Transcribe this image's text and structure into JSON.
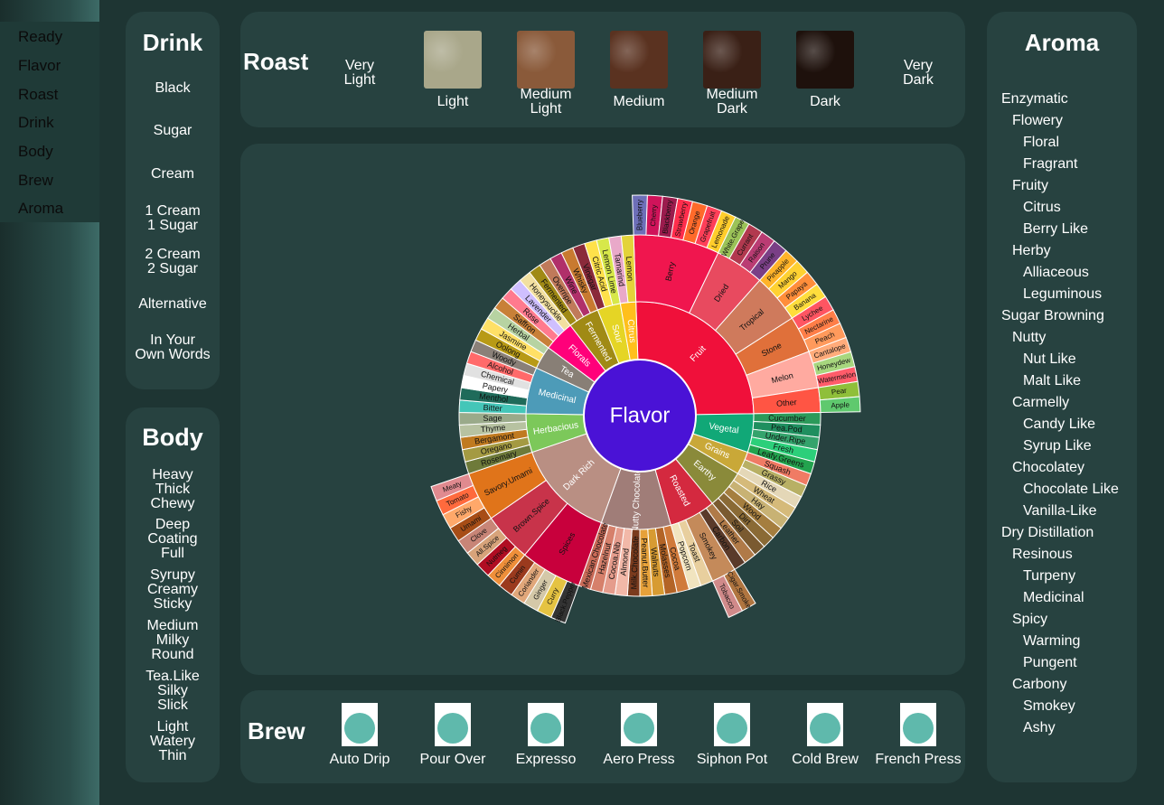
{
  "nav": {
    "items": [
      "Ready",
      "Flavor",
      "Roast",
      "Drink",
      "Body",
      "Brew",
      "Aroma"
    ]
  },
  "drink": {
    "title": "Drink",
    "options": [
      "Black",
      "Sugar",
      "Cream",
      "1 Cream\n1 Sugar",
      "2 Cream\n2 Sugar",
      "Alternative",
      "In Your\nOwn Words"
    ]
  },
  "body": {
    "title": "Body",
    "options": [
      "Heavy\nThick\nChewy",
      "Deep\nCoating\nFull",
      "Syrupy\nCreamy\nSticky",
      "Medium\nMilky\nRound",
      "Tea.Like\nSilky\nSlick",
      "Light\nWatery\nThin"
    ]
  },
  "roast": {
    "title": "Roast",
    "options": [
      {
        "label": "Very\nLight",
        "image": false
      },
      {
        "label": "Light",
        "image": true,
        "color": "#a9a78a"
      },
      {
        "label": "Medium\nLight",
        "image": true,
        "color": "#8a5a3a"
      },
      {
        "label": "Medium",
        "image": true,
        "color": "#5a3220"
      },
      {
        "label": "Medium\nDark",
        "image": true,
        "color": "#3a2016"
      },
      {
        "label": "Dark",
        "image": true,
        "color": "#1e110c"
      },
      {
        "label": "Very\nDark",
        "image": false
      }
    ]
  },
  "brew": {
    "title": "Brew",
    "options": [
      "Auto Drip",
      "Pour Over",
      "Expresso",
      "Aero Press",
      "Siphon Pot",
      "Cold Brew",
      "French Press"
    ]
  },
  "aroma": {
    "title": "Aroma",
    "items": [
      {
        "label": "Enzymatic",
        "level": 0
      },
      {
        "label": "Flowery",
        "level": 1
      },
      {
        "label": "Floral",
        "level": 2
      },
      {
        "label": "Fragrant",
        "level": 2
      },
      {
        "label": "Fruity",
        "level": 1
      },
      {
        "label": "Citrus",
        "level": 2
      },
      {
        "label": "Berry Like",
        "level": 2
      },
      {
        "label": "Herby",
        "level": 1
      },
      {
        "label": "Alliaceous",
        "level": 2
      },
      {
        "label": "Leguminous",
        "level": 2
      },
      {
        "label": "Sugar Browning",
        "level": 0
      },
      {
        "label": "Nutty",
        "level": 1
      },
      {
        "label": "Nut Like",
        "level": 2
      },
      {
        "label": "Malt Like",
        "level": 2
      },
      {
        "label": "Carmelly",
        "level": 1
      },
      {
        "label": "Candy Like",
        "level": 2
      },
      {
        "label": "Syrup Like",
        "level": 2
      },
      {
        "label": "Chocolatey",
        "level": 1
      },
      {
        "label": "Chocolate Like",
        "level": 2
      },
      {
        "label": "Vanilla-Like",
        "level": 2
      },
      {
        "label": "Dry Distillation",
        "level": 0
      },
      {
        "label": "Resinous",
        "level": 1
      },
      {
        "label": "Turpeny",
        "level": 2
      },
      {
        "label": "Medicinal",
        "level": 2
      },
      {
        "label": "Spicy",
        "level": 1
      },
      {
        "label": "Warming",
        "level": 2
      },
      {
        "label": "Pungent",
        "level": 2
      },
      {
        "label": "Carbony",
        "level": 1
      },
      {
        "label": "Smokey",
        "level": 2
      },
      {
        "label": "Ashy",
        "level": 2
      }
    ]
  },
  "flavor": {
    "center": "Flavor",
    "center_color": "#4a12d6",
    "wheel": [
      {
        "name": "Fruit",
        "color": "#f0103a",
        "children": [
          {
            "name": "Berry",
            "color": "#f0164e",
            "children": [
              {
                "name": "Blueberry",
                "color": "#6d6fb8"
              },
              {
                "name": "Cherry",
                "color": "#d0135a"
              },
              {
                "name": "Blackberry",
                "color": "#9b1b4d"
              },
              {
                "name": "Strawberry",
                "color": "#ff2d4c"
              },
              {
                "name": "Orange",
                "color": "#ff6a2a"
              },
              {
                "name": "Grapefruit",
                "color": "#ff3f58"
              },
              {
                "name": "Lemonade",
                "color": "#ffcd2b"
              }
            ]
          },
          {
            "name": "Dried",
            "color": "#e84a5f",
            "children": [
              {
                "name": "White.Grape",
                "color": "#9bc358"
              },
              {
                "name": "Currant",
                "color": "#b2394f"
              },
              {
                "name": "Raison",
                "color": "#ba3c73"
              },
              {
                "name": "Prune",
                "color": "#7a3f86"
              }
            ]
          },
          {
            "name": "Tropical",
            "color": "#cf7a5c",
            "children": [
              {
                "name": "Pinapple",
                "color": "#ffb329"
              },
              {
                "name": "Mango",
                "color": "#ffd131"
              },
              {
                "name": "Papaya",
                "color": "#ff8e3a"
              },
              {
                "name": "Banana",
                "color": "#ffdd3c"
              }
            ]
          },
          {
            "name": "Stone",
            "color": "#e0703a",
            "children": [
              {
                "name": "Lychee",
                "color": "#ff5562"
              },
              {
                "name": "Nectarine",
                "color": "#ff7e48"
              },
              {
                "name": "Peach",
                "color": "#ff9a5c"
              }
            ]
          },
          {
            "name": "Melon",
            "color": "#ffaaa0",
            "children": [
              {
                "name": "Cantalope",
                "color": "#ffab7a"
              },
              {
                "name": "Honeydew",
                "color": "#a7d77e"
              },
              {
                "name": "Watermelon",
                "color": "#ff5c6a"
              }
            ]
          },
          {
            "name": "Other",
            "color": "#ff5544",
            "children": [
              {
                "name": "Pear",
                "color": "#8fbf3a"
              },
              {
                "name": "Apple",
                "color": "#5fc96e"
              }
            ]
          }
        ]
      },
      {
        "name": "Vegetal",
        "color": "#11a877",
        "children": [
          {
            "name": "Cucumber",
            "color": "#2b9a5a",
            "children": []
          },
          {
            "name": "Pea.Pod",
            "color": "#1f8f5f",
            "children": []
          },
          {
            "name": "Under.Ripe",
            "color": "#34a36c",
            "children": []
          },
          {
            "name": "Fresh",
            "color": "#2ccf7a",
            "children": []
          },
          {
            "name": "Leafy.Greens",
            "color": "#23a34e",
            "children": []
          }
        ]
      },
      {
        "name": "Grains",
        "color": "#c9a838",
        "children": [
          {
            "name": "Squash",
            "color": "#f07b64",
            "children": []
          },
          {
            "name": "Grassy",
            "color": "#b8b065",
            "children": []
          },
          {
            "name": "Rice",
            "color": "#e4d7b7",
            "children": []
          }
        ]
      },
      {
        "name": "Earthy",
        "color": "#8a8a3a",
        "children": [
          {
            "name": "Wheat",
            "color": "#d5ba7a",
            "children": []
          },
          {
            "name": "Hay",
            "color": "#c8b274",
            "children": []
          },
          {
            "name": "Wood",
            "color": "#a57e3f",
            "children": []
          },
          {
            "name": "Dirt",
            "color": "#8a6a35",
            "children": []
          },
          {
            "name": "Soil",
            "color": "#7a5a30",
            "children": []
          }
        ]
      },
      {
        "name": "Roasted",
        "color": "#d4293f",
        "children": [
          {
            "name": "Leather",
            "color": "#b07a48",
            "children": []
          },
          {
            "name": "Carbon",
            "color": "#5a3a2a",
            "children": []
          },
          {
            "name": "Smokey",
            "color": "#c48a5a",
            "children": [
              {
                "name": "Cigar.Smoke",
                "color": "#b07540"
              },
              {
                "name": "Tobacco",
                "color": "#d08a8a"
              }
            ]
          },
          {
            "name": "Toast",
            "color": "#e8cf9e",
            "children": []
          },
          {
            "name": "Popcorn",
            "color": "#f1e4bf",
            "children": []
          }
        ]
      },
      {
        "name": "Nutty Chocolate",
        "color": "#a07d78",
        "children": [
          {
            "name": "Cocoa",
            "color": "#d07a3a",
            "children": []
          },
          {
            "name": "Molasses",
            "color": "#b36426",
            "children": []
          },
          {
            "name": "Walnuts",
            "color": "#d79b32",
            "children": []
          },
          {
            "name": "Peanut.Butter",
            "color": "#e6a13a",
            "children": []
          },
          {
            "name": "Milk.Chocolate",
            "color": "#7a3b1e",
            "children": []
          },
          {
            "name": "Almond",
            "color": "#f2b8a8",
            "children": []
          },
          {
            "name": "Cocoa.Nib",
            "color": "#e59c8c",
            "children": []
          },
          {
            "name": "Hazelnut",
            "color": "#d6806b",
            "children": []
          },
          {
            "name": "Mexican.Chocolate",
            "color": "#c96a57",
            "children": []
          }
        ]
      },
      {
        "name": "Dark Rich",
        "color": "#b98f83",
        "children": [
          {
            "name": "Spices",
            "color": "#c8003c",
            "children": [
              {
                "name": "Black.Pepper",
                "color": "#333"
              },
              {
                "name": "Curry",
                "color": "#e5c342"
              },
              {
                "name": "Ginger",
                "color": "#d4c8a8"
              },
              {
                "name": "Coriander",
                "color": "#e1a77a"
              },
              {
                "name": "Cumin",
                "color": "#9b3a1e"
              }
            ]
          },
          {
            "name": "Brown.Spice",
            "color": "#c8334a",
            "children": [
              {
                "name": "Cinnimon",
                "color": "#ef8f3a"
              },
              {
                "name": "Nutmeg",
                "color": "#b00d22"
              },
              {
                "name": "All.Spice",
                "color": "#d7a37a"
              },
              {
                "name": "Clove",
                "color": "#c88577"
              }
            ]
          },
          {
            "name": "Savory.Umami",
            "color": "#e0741a",
            "children": [
              {
                "name": "Umami",
                "color": "#a74d16"
              },
              {
                "name": "Fishy",
                "color": "#ffa86a"
              },
              {
                "name": "Tomato",
                "color": "#ff6a3d"
              },
              {
                "name": "Meaty",
                "color": "#e08a8f"
              }
            ]
          }
        ]
      },
      {
        "name": "Herbacious",
        "color": "#7cc85a",
        "children": [
          {
            "name": "Rosemary",
            "color": "#6e7a3a",
            "children": []
          },
          {
            "name": "Oregano",
            "color": "#a49a42",
            "children": []
          },
          {
            "name": "Bergamont",
            "color": "#c07a20",
            "children": []
          },
          {
            "name": "Thyme",
            "color": "#b7c2a1",
            "children": []
          },
          {
            "name": "Sage",
            "color": "#9aaa8a",
            "children": []
          }
        ]
      },
      {
        "name": "Medicinal",
        "color": "#4d9bb8",
        "children": [
          {
            "name": "Bitter",
            "color": "#44c6b8",
            "children": []
          },
          {
            "name": "Menthol",
            "color": "#1f6b5a",
            "children": []
          },
          {
            "name": "Papery",
            "color": "#ffffff",
            "children": []
          },
          {
            "name": "Chemical",
            "color": "#e1e1e1",
            "children": []
          },
          {
            "name": "Alcohol",
            "color": "#ff6a6a",
            "children": []
          },
          {
            "name": "Woody",
            "color": "#8a8078",
            "children": []
          }
        ]
      },
      {
        "name": "Tea",
        "color": "#887f76",
        "children": [
          {
            "name": "Oolong",
            "color": "#b89a15",
            "children": []
          },
          {
            "name": "Jasmine",
            "color": "#ffe066",
            "children": []
          },
          {
            "name": "Herbal",
            "color": "#b7d3a2",
            "children": []
          }
        ]
      },
      {
        "name": "Florals",
        "color": "#ff007a",
        "children": [
          {
            "name": "Saffron",
            "color": "#c88038",
            "children": []
          },
          {
            "name": "Rose",
            "color": "#ff7a8e",
            "children": []
          },
          {
            "name": "Lavender",
            "color": "#cfbfff",
            "children": []
          },
          {
            "name": "Honeysuckle",
            "color": "#f2e0a0",
            "children": []
          }
        ]
      },
      {
        "name": "Fermented",
        "color": "#a08a15",
        "children": [
          {
            "name": "Fermented",
            "color": "#a08a15",
            "children": []
          },
          {
            "name": "Overripe",
            "color": "#c07a5a",
            "children": []
          },
          {
            "name": "Wine",
            "color": "#b0306a",
            "children": []
          },
          {
            "name": "Whisky",
            "color": "#c87a30",
            "children": []
          }
        ]
      },
      {
        "name": "Sour",
        "color": "#e5d525",
        "children": [
          {
            "name": "Vinegar",
            "color": "#8a2a3a",
            "children": []
          },
          {
            "name": "Citric Acid",
            "color": "#ffe14a",
            "children": []
          },
          {
            "name": "Lemon Lime",
            "color": "#d7e84a",
            "children": []
          }
        ]
      },
      {
        "name": "Citrus",
        "color": "#ffbf1c",
        "children": [
          {
            "name": "Tamarind",
            "color": "#e9a9c9",
            "children": []
          },
          {
            "name": "Lemon",
            "color": "#e3d33a",
            "children": []
          }
        ]
      }
    ]
  }
}
